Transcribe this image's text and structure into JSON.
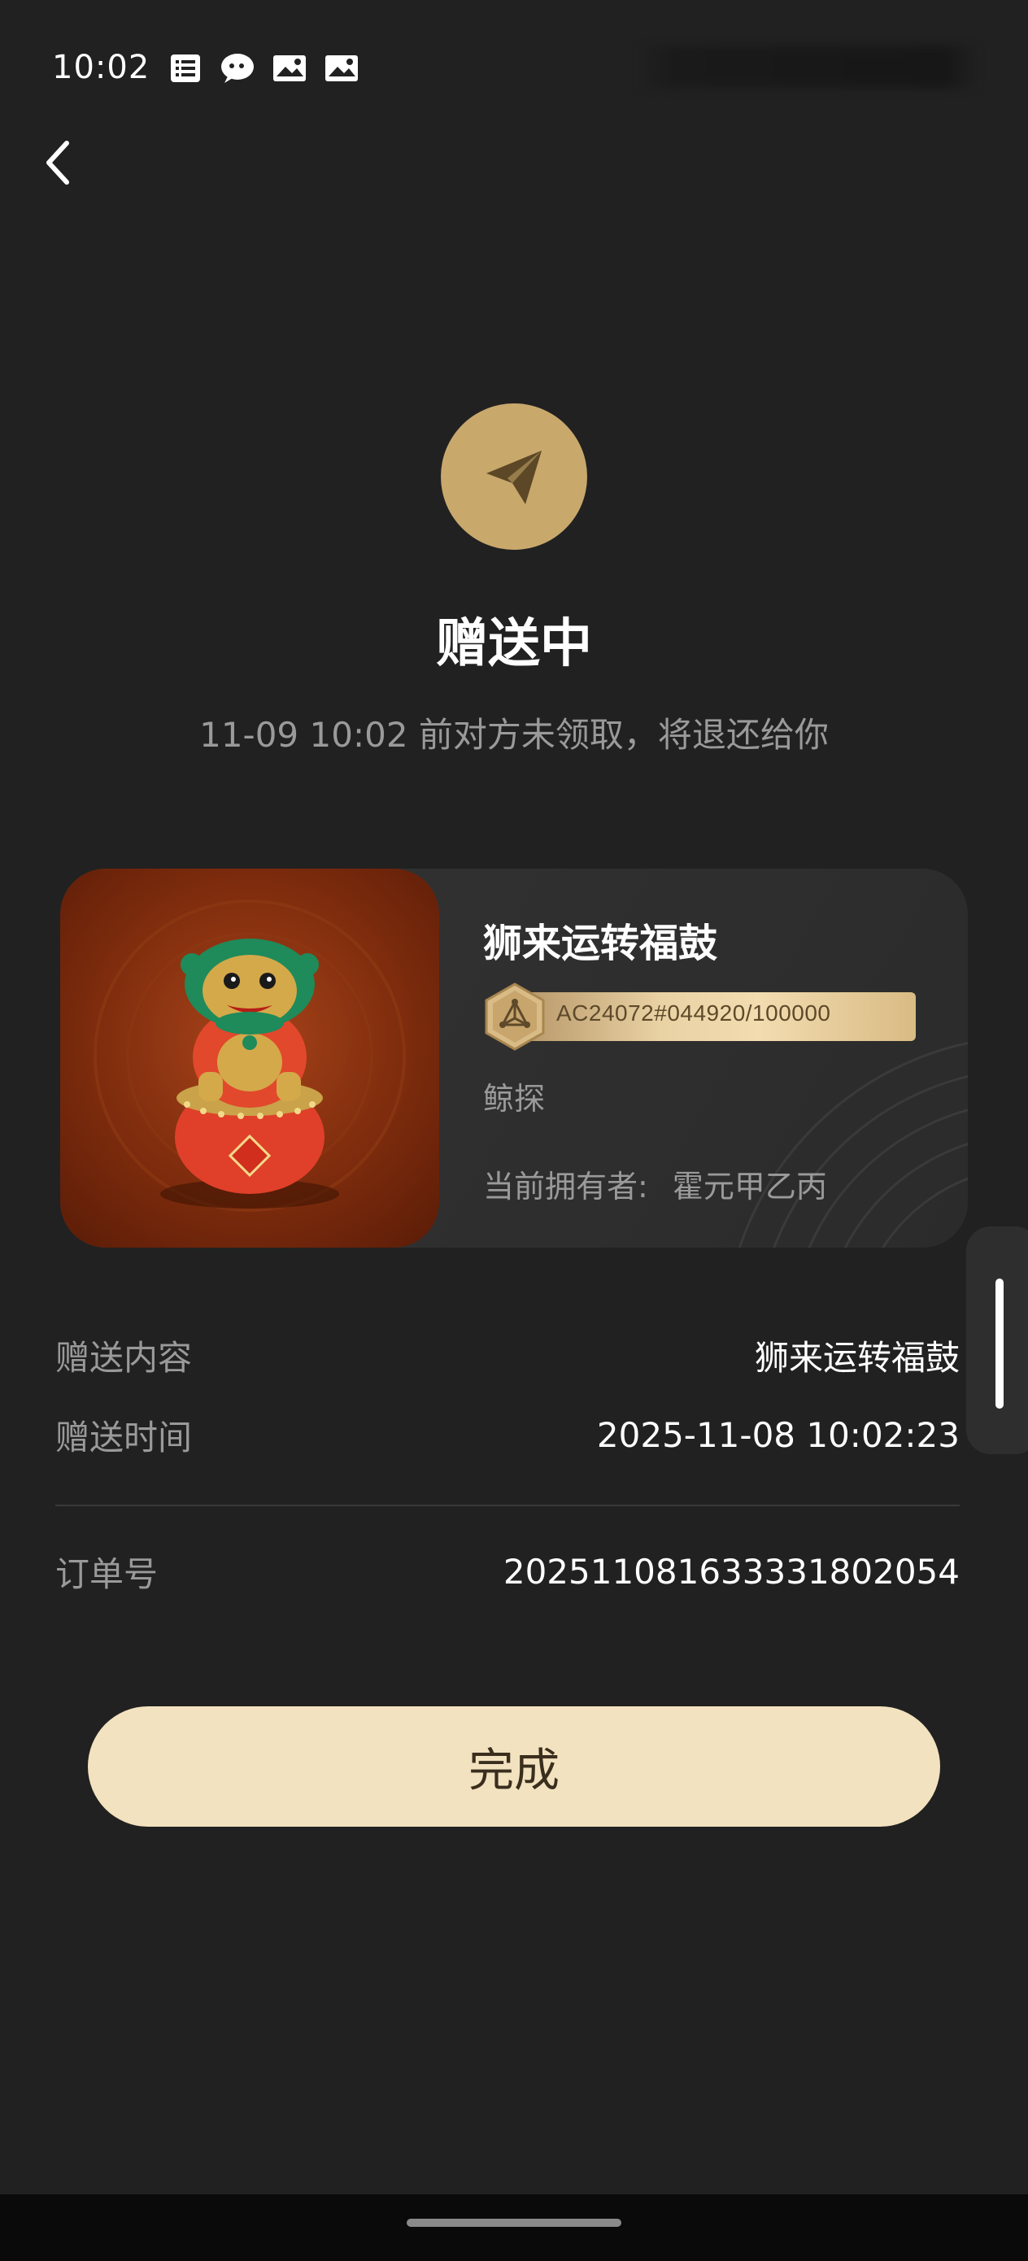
{
  "status_bar": {
    "time": "10:02",
    "icons": [
      "list-icon",
      "chat-bubble-icon",
      "image-message-icon",
      "image-message-icon"
    ]
  },
  "header": {
    "back_icon": "chevron-left-icon"
  },
  "hero": {
    "icon": "paper-plane-icon",
    "title": "赠送中",
    "subtitle": "11-09 10:02 前对方未领取，将退还给你"
  },
  "card": {
    "name": "狮来运转福鼓",
    "serial": "AC24072#044920/100000",
    "creator": "鲸探",
    "owner_label": "当前拥有者:",
    "owner_name": "霍元甲乙丙"
  },
  "details": {
    "content_label": "赠送内容",
    "content_value": "狮来运转福鼓",
    "time_label": "赠送时间",
    "time_value": "2025-11-08 10:02:23",
    "order_label": "订单号",
    "order_value": "20251108163333180205​4"
  },
  "done_button": {
    "label": "完成"
  },
  "colors": {
    "background": "#212121",
    "accent_gold": "#c9a86c",
    "button_bg": "#f3e2bf",
    "muted_text": "#9a9a9a"
  }
}
